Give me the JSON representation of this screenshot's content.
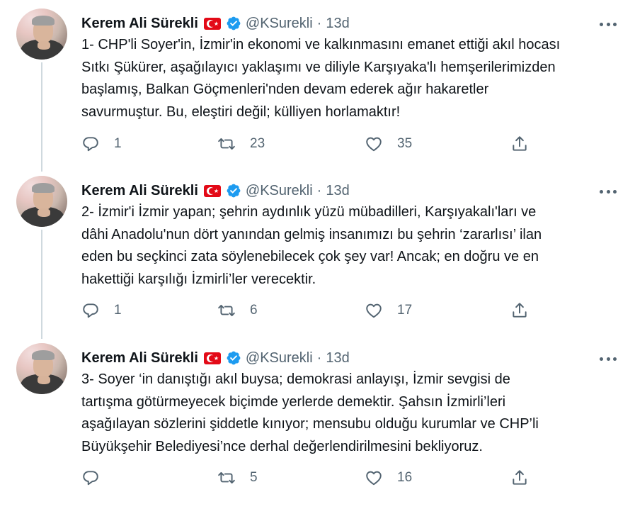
{
  "tweets": [
    {
      "name": "Kerem Ali Sürekli",
      "handle": "@KSurekli",
      "separator": "·",
      "time": "13d",
      "text": "1- CHP'li Soyer'in, İzmir'in ekonomi ve kalkınmasını emanet ettiği akıl hocası\nSıtkı Şükürer, aşağılayıcı yaklaşımı ve diliyle Karşıyaka'lı hemşerilerimizden\nbaşlamış, Balkan Göçmenleri'nden devam ederek ağır hakaretler\nsavurmuştur. Bu, eleştiri değil; külliyen horlamaktır!",
      "replies": "1",
      "retweets": "23",
      "likes": "35"
    },
    {
      "name": "Kerem Ali Sürekli",
      "handle": "@KSurekli",
      "separator": "·",
      "time": "13d",
      "text": "2- İzmir'i İzmir yapan; şehrin aydınlık yüzü mübadilleri, Karşıyakalı'ları ve\ndâhi Anadolu'nun dört yanından gelmiş insanımızı bu şehrin ‘zararlısı’ ilan\neden bu seçkinci zata söylenebilecek çok şey var! Ancak; en doğru ve en\nhakettiği karşılığı İzmirli’ler verecektir.",
      "replies": "1",
      "retweets": "6",
      "likes": "17"
    },
    {
      "name": "Kerem Ali Sürekli",
      "handle": "@KSurekli",
      "separator": "·",
      "time": "13d",
      "text": "3- Soyer ‘in danıştığı akıl buysa; demokrasi anlayışı, İzmir sevgisi de\ntartışma götürmeyecek biçimde yerlerde demektir.  Şahsın İzmirli’leri\naşağılayan sözlerini şiddetle kınıyor; mensubu olduğu kurumlar ve  CHP’li\nBüyükşehir Belediyesi’nce derhal değerlendirilmesini bekliyoruz.",
      "replies": "",
      "retweets": "5",
      "likes": "16"
    }
  ],
  "icons": {
    "reply": "reply-icon",
    "retweet": "retweet-icon",
    "like": "heart-icon",
    "share": "share-icon",
    "more": "more-icon",
    "verified": "verified-badge-icon",
    "flag": "turkey-flag-icon"
  },
  "colors": {
    "text": "#0f1419",
    "secondary": "#536471",
    "verified": "#1d9bf0",
    "thread_line": "#cfd9de",
    "flag_red": "#e30a17"
  }
}
